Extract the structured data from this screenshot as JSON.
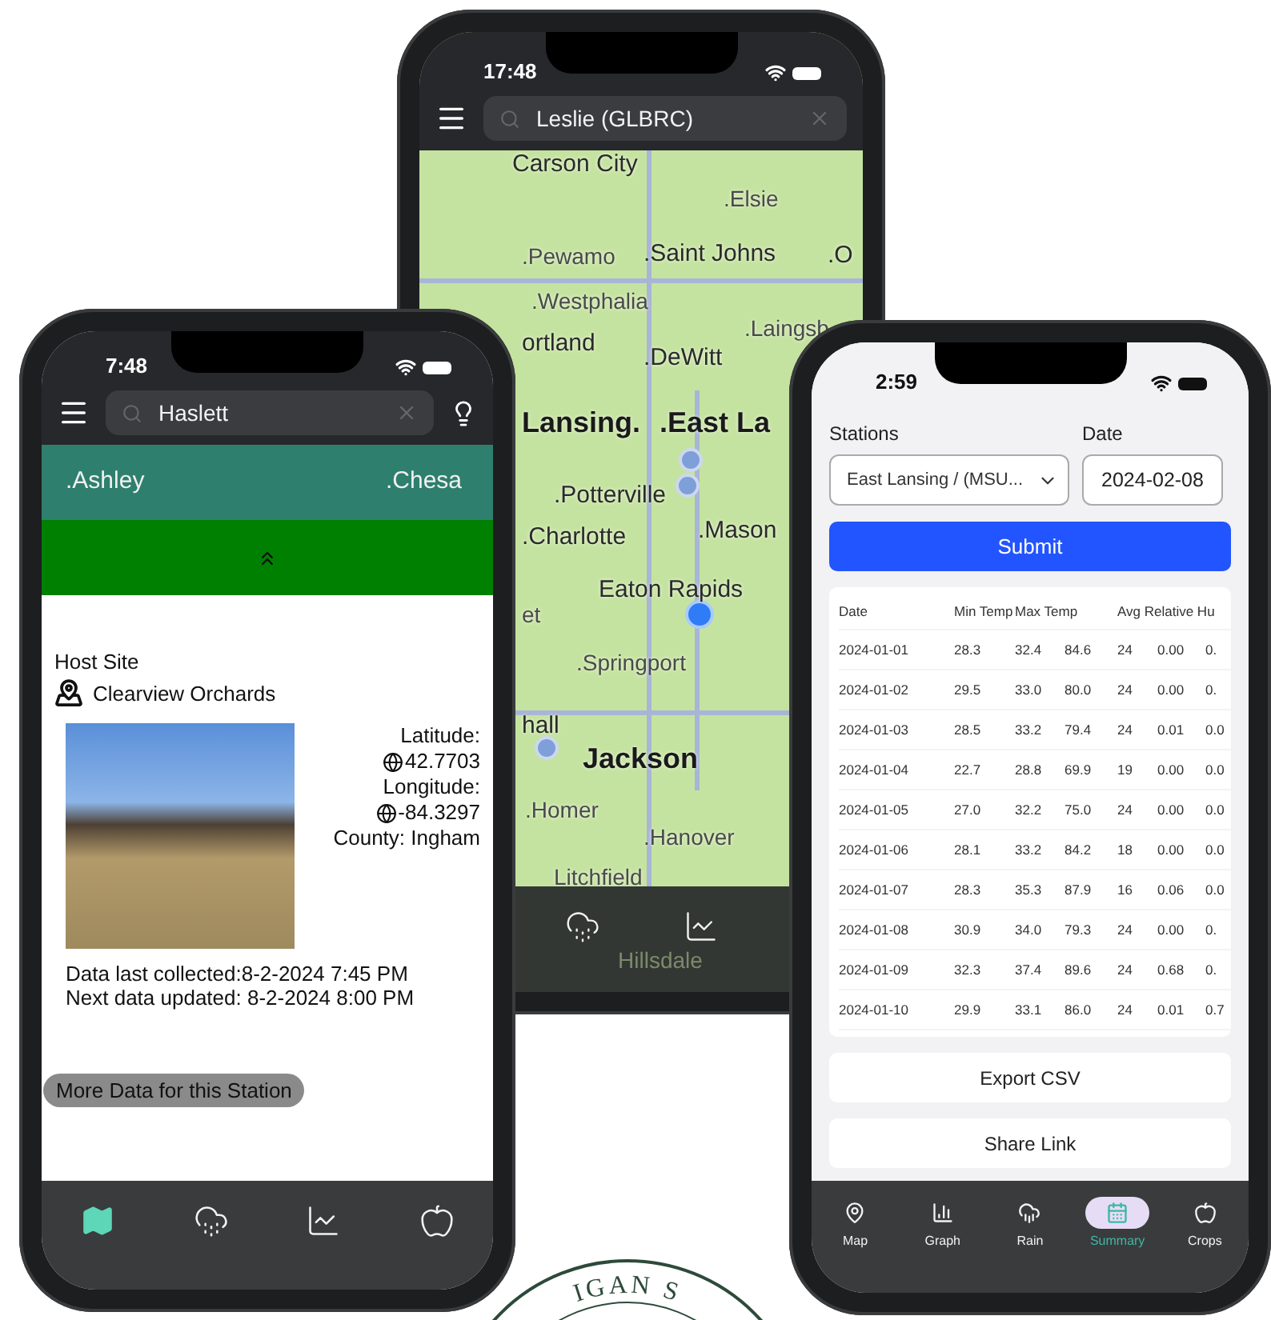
{
  "map_phone": {
    "status_time": "17:48",
    "search": {
      "value": "Leslie (GLBRC)"
    },
    "map_labels": [
      {
        "text": "Carson City",
        "kind": "town"
      },
      {
        "text": ".Elsie",
        "kind": "village"
      },
      {
        "text": ".Pewamo",
        "kind": "village"
      },
      {
        "text": ".Saint Johns",
        "kind": "town"
      },
      {
        "text": ".O",
        "kind": "town"
      },
      {
        "text": ".Westphalia",
        "kind": "village"
      },
      {
        "text": "ortland",
        "kind": "town"
      },
      {
        "text": ".Laingsb",
        "kind": "village"
      },
      {
        "text": ".DeWitt",
        "kind": "town"
      },
      {
        "text": "Lansing.",
        "kind": "city"
      },
      {
        "text": ".East La",
        "kind": "city"
      },
      {
        "text": ".Potterville",
        "kind": "town"
      },
      {
        "text": ".Charlotte",
        "kind": "town"
      },
      {
        "text": ".Mason",
        "kind": "town"
      },
      {
        "text": "et",
        "kind": "village"
      },
      {
        "text": "Eaton Rapids",
        "kind": "town"
      },
      {
        "text": ".Springport",
        "kind": "village"
      },
      {
        "text": "hall",
        "kind": "town"
      },
      {
        "text": "Jackson",
        "kind": "city"
      },
      {
        "text": ".Homer",
        "kind": "village"
      },
      {
        "text": ".Hanover",
        "kind": "village"
      },
      {
        "text": "Litchfield",
        "kind": "village"
      },
      {
        "text": "Hillsdale",
        "kind": "faint"
      }
    ],
    "tabs": [
      {
        "selected": false
      },
      {
        "selected": false
      }
    ]
  },
  "station_phone": {
    "status_time": "7:48",
    "search": {
      "value": "Haslett"
    },
    "map_labels": [
      {
        "text": ".Ashley"
      },
      {
        "text": ".Chesa"
      }
    ],
    "section_title": "Host Site",
    "site_name": "Clearview Orchards",
    "latitude_label": "Latitude:",
    "latitude": "42.7703",
    "longitude_label": "Longitude:",
    "longitude": "-84.3297",
    "county": "County: Ingham",
    "last_collected": "Data last collected:8-2-2024 7:45 PM",
    "next_update": "Next data updated: 8-2-2024 8:00 PM",
    "more_button": "More Data for this Station",
    "tabs": [
      {
        "selected": true
      },
      {
        "selected": false
      },
      {
        "selected": false
      },
      {
        "selected": false
      }
    ]
  },
  "summary_phone": {
    "status_time": "2:59",
    "station_label": "Stations",
    "station_value": "East Lansing / (MSU...",
    "date_label": "Date",
    "date_value": "2024-02-08",
    "submit": "Submit",
    "table": {
      "columns": [
        "Date",
        "Min Temp",
        "Max Temp",
        "",
        "Avg Relative Hu"
      ],
      "rows": [
        [
          "2024-01-01",
          "28.3",
          "32.4",
          "84.6",
          "24",
          "0.00",
          "0."
        ],
        [
          "2024-01-02",
          "29.5",
          "33.0",
          "80.0",
          "24",
          "0.00",
          "0."
        ],
        [
          "2024-01-03",
          "28.5",
          "33.2",
          "79.4",
          "24",
          "0.01",
          "0.0"
        ],
        [
          "2024-01-04",
          "22.7",
          "28.8",
          "69.9",
          "19",
          "0.00",
          "0.0"
        ],
        [
          "2024-01-05",
          "27.0",
          "32.2",
          "75.0",
          "24",
          "0.00",
          "0.0"
        ],
        [
          "2024-01-06",
          "28.1",
          "33.2",
          "84.2",
          "18",
          "0.00",
          "0.0"
        ],
        [
          "2024-01-07",
          "28.3",
          "35.3",
          "87.9",
          "16",
          "0.06",
          "0.0"
        ],
        [
          "2024-01-08",
          "30.9",
          "34.0",
          "79.3",
          "24",
          "0.00",
          "0."
        ],
        [
          "2024-01-09",
          "32.3",
          "37.4",
          "89.6",
          "24",
          "0.68",
          "0."
        ],
        [
          "2024-01-10",
          "29.9",
          "33.1",
          "86.0",
          "24",
          "0.01",
          "0.7"
        ]
      ]
    },
    "export_button": "Export CSV",
    "share_button": "Share Link",
    "tabs": [
      {
        "label": "Map",
        "selected": false
      },
      {
        "label": "Graph",
        "selected": false
      },
      {
        "label": "Rain",
        "selected": false
      },
      {
        "label": "Summary",
        "selected": true
      },
      {
        "label": "Crops",
        "selected": false
      }
    ]
  },
  "seal": {
    "text": "IGAN S"
  }
}
